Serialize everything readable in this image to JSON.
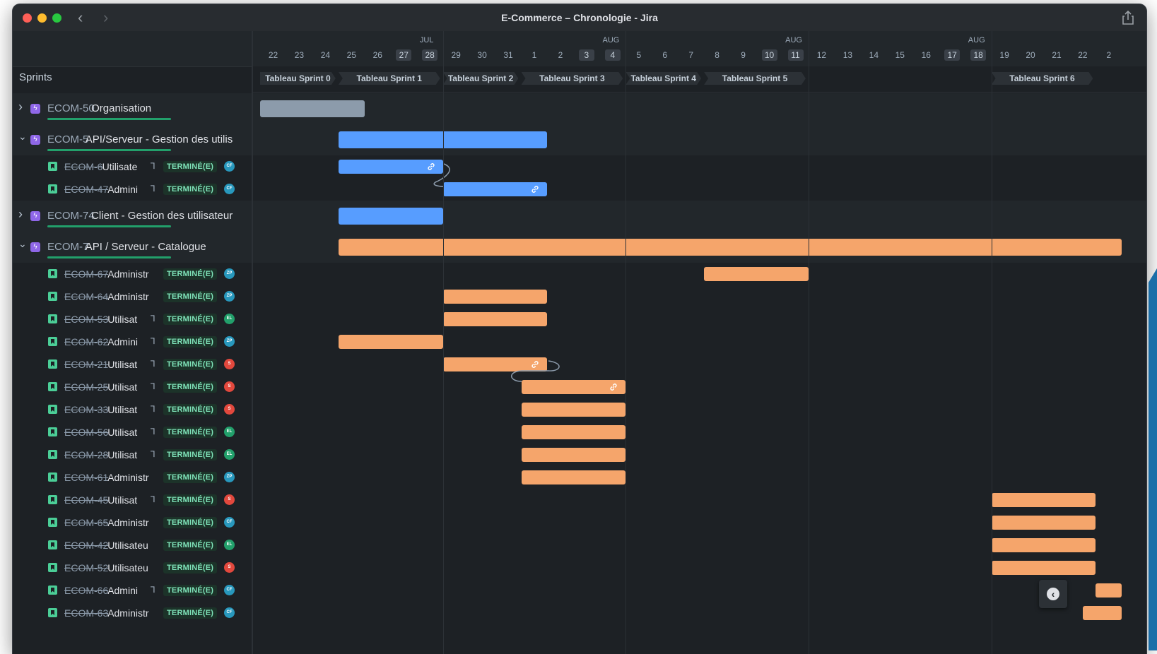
{
  "window": {
    "title": "E-Commerce – Chronologie - Jira"
  },
  "colors": {
    "blue": "#579dff",
    "orange": "#f5a56b",
    "gray": "#8c9bab",
    "done_badge": "#7ee2b8",
    "epic": "#8f67e8"
  },
  "left": {
    "sprints_label": "Sprints"
  },
  "timeline": {
    "months": [
      "JUL",
      "AUG",
      "AUG",
      "AUG",
      "AUG"
    ],
    "days": [
      {
        "d": "22"
      },
      {
        "d": "23"
      },
      {
        "d": "24"
      },
      {
        "d": "25"
      },
      {
        "d": "26"
      },
      {
        "d": "27",
        "we": true
      },
      {
        "d": "28",
        "we": true
      },
      {
        "d": "29"
      },
      {
        "d": "30"
      },
      {
        "d": "31"
      },
      {
        "d": "1"
      },
      {
        "d": "2"
      },
      {
        "d": "3",
        "we": true
      },
      {
        "d": "4",
        "we": true
      },
      {
        "d": "5"
      },
      {
        "d": "6"
      },
      {
        "d": "7"
      },
      {
        "d": "8"
      },
      {
        "d": "9"
      },
      {
        "d": "10",
        "we": true
      },
      {
        "d": "11",
        "we": true
      },
      {
        "d": "12"
      },
      {
        "d": "13"
      },
      {
        "d": "14"
      },
      {
        "d": "15"
      },
      {
        "d": "16"
      },
      {
        "d": "17",
        "we": true
      },
      {
        "d": "18",
        "we": true
      },
      {
        "d": "19"
      },
      {
        "d": "20"
      },
      {
        "d": "21"
      },
      {
        "d": "22"
      },
      {
        "d": "2"
      }
    ],
    "sprints": [
      {
        "name": "Tableau Sprint 0",
        "start": 0,
        "end": 3
      },
      {
        "name": "Tableau Sprint 1",
        "start": 3,
        "end": 7
      },
      {
        "name": "Tableau Sprint 2",
        "start": 7,
        "end": 10
      },
      {
        "name": "Tableau Sprint 3",
        "start": 10,
        "end": 14
      },
      {
        "name": "Tableau Sprint 4",
        "start": 14,
        "end": 17
      },
      {
        "name": "Tableau Sprint 5",
        "start": 17,
        "end": 21
      },
      {
        "name": "Tableau Sprint 6",
        "start": 28,
        "end": 32
      }
    ]
  },
  "rows": [
    {
      "type": "epic",
      "expanded": false,
      "key": "ECOM-50",
      "title": "Organisation",
      "color": "gray",
      "start": 0,
      "end": 4
    },
    {
      "type": "epic",
      "expanded": true,
      "key": "ECOM-5",
      "title": "API/Serveur - Gestion des utilis",
      "color": "blue",
      "start": 3,
      "end": 11
    },
    {
      "type": "story",
      "key": "ECOM-6",
      "title": "Utilisate",
      "child": true,
      "status": "TERMINÉ(E)",
      "avatar": "CF",
      "avatar_color": "#2898bd",
      "color": "blue",
      "start": 3,
      "end": 7,
      "link": true
    },
    {
      "type": "story",
      "key": "ECOM-47",
      "title": "Admini",
      "child": true,
      "status": "TERMINÉ(E)",
      "avatar": "CF",
      "avatar_color": "#2898bd",
      "color": "blue",
      "start": 7,
      "end": 11,
      "link": true
    },
    {
      "type": "epic",
      "expanded": false,
      "key": "ECOM-74",
      "title": "Client - Gestion des utilisateur",
      "color": "blue",
      "start": 3,
      "end": 7
    },
    {
      "type": "epic",
      "expanded": true,
      "key": "ECOM-7",
      "title": "API / Serveur - Catalogue",
      "color": "orange",
      "start": 3,
      "end": 33
    },
    {
      "type": "story",
      "key": "ECOM-67",
      "title": "Administr",
      "child": false,
      "status": "TERMINÉ(E)",
      "avatar": "ZP",
      "avatar_color": "#2898bd",
      "color": "orange",
      "start": 17,
      "end": 21
    },
    {
      "type": "story",
      "key": "ECOM-64",
      "title": "Administr",
      "child": false,
      "status": "TERMINÉ(E)",
      "avatar": "ZP",
      "avatar_color": "#2898bd",
      "color": "orange",
      "start": 7,
      "end": 11
    },
    {
      "type": "story",
      "key": "ECOM-53",
      "title": "Utilisat",
      "child": true,
      "status": "TERMINÉ(E)",
      "avatar": "EL",
      "avatar_color": "#22a06b",
      "color": "orange",
      "start": 7,
      "end": 11
    },
    {
      "type": "story",
      "key": "ECOM-62",
      "title": "Admini",
      "child": true,
      "status": "TERMINÉ(E)",
      "avatar": "ZP",
      "avatar_color": "#2898bd",
      "color": "orange",
      "start": 3,
      "end": 7
    },
    {
      "type": "story",
      "key": "ECOM-21",
      "title": "Utilisat",
      "child": true,
      "status": "TERMINÉ(E)",
      "avatar": "S",
      "avatar_color": "#e2483d",
      "color": "orange",
      "start": 7,
      "end": 11,
      "link": true
    },
    {
      "type": "story",
      "key": "ECOM-25",
      "title": "Utilisat",
      "child": true,
      "status": "TERMINÉ(E)",
      "avatar": "S",
      "avatar_color": "#e2483d",
      "color": "orange",
      "start": 10,
      "end": 14,
      "link": true
    },
    {
      "type": "story",
      "key": "ECOM-33",
      "title": "Utilisat",
      "child": true,
      "status": "TERMINÉ(E)",
      "avatar": "S",
      "avatar_color": "#e2483d",
      "color": "orange",
      "start": 10,
      "end": 14
    },
    {
      "type": "story",
      "key": "ECOM-56",
      "title": "Utilisat",
      "child": true,
      "status": "TERMINÉ(E)",
      "avatar": "EL",
      "avatar_color": "#22a06b",
      "color": "orange",
      "start": 10,
      "end": 14
    },
    {
      "type": "story",
      "key": "ECOM-28",
      "title": "Utilisat",
      "child": true,
      "status": "TERMINÉ(E)",
      "avatar": "EL",
      "avatar_color": "#22a06b",
      "color": "orange",
      "start": 10,
      "end": 14
    },
    {
      "type": "story",
      "key": "ECOM-61",
      "title": "Administr",
      "child": false,
      "status": "TERMINÉ(E)",
      "avatar": "ZP",
      "avatar_color": "#2898bd",
      "color": "orange",
      "start": 10,
      "end": 14
    },
    {
      "type": "story",
      "key": "ECOM-45",
      "title": "Utilisat",
      "child": true,
      "status": "TERMINÉ(E)",
      "avatar": "S",
      "avatar_color": "#e2483d",
      "color": "orange",
      "start": 28,
      "end": 32
    },
    {
      "type": "story",
      "key": "ECOM-65",
      "title": "Administr",
      "child": false,
      "status": "TERMINÉ(E)",
      "avatar": "CF",
      "avatar_color": "#2898bd",
      "color": "orange",
      "start": 28,
      "end": 32
    },
    {
      "type": "story",
      "key": "ECOM-42",
      "title": "Utilisateu",
      "child": false,
      "status": "TERMINÉ(E)",
      "avatar": "EL",
      "avatar_color": "#22a06b",
      "color": "orange",
      "start": 28,
      "end": 32
    },
    {
      "type": "story",
      "key": "ECOM-52",
      "title": "Utilisateu",
      "child": false,
      "status": "TERMINÉ(E)",
      "avatar": "S",
      "avatar_color": "#e2483d",
      "color": "orange",
      "start": 28,
      "end": 32
    },
    {
      "type": "story",
      "key": "ECOM-66",
      "title": "Admini",
      "child": true,
      "status": "TERMINÉ(E)",
      "avatar": "CF",
      "avatar_color": "#2898bd",
      "color": "orange",
      "start": 32,
      "end": 33
    },
    {
      "type": "story",
      "key": "ECOM-63",
      "title": "Administr",
      "child": false,
      "status": "TERMINÉ(E)",
      "avatar": "CF",
      "avatar_color": "#2898bd",
      "color": "orange",
      "start": 31.5,
      "end": 33
    }
  ]
}
